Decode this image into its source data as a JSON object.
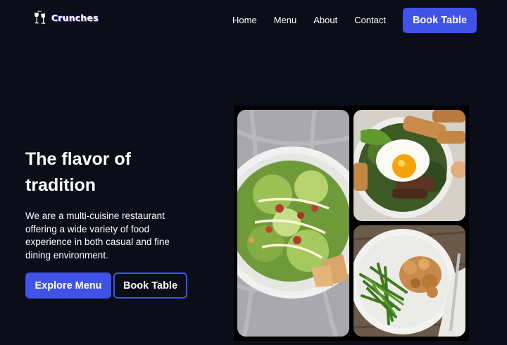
{
  "header": {
    "logo_text": "Crunches",
    "logo_icon": "wine-glasses-icon",
    "nav": [
      "Home",
      "Menu",
      "About",
      "Contact"
    ],
    "cta_label": "Book Table"
  },
  "hero": {
    "title_line1": "The flavor of",
    "title_line2": "tradition",
    "description": "We are a multi-cuisine restaurant offering a wide variety of food experience in both casual and fine dining environment.",
    "primary_button": "Explore Menu",
    "secondary_button": "Book Table"
  },
  "colors": {
    "background": "#0b0e18",
    "accent": "#4152e8",
    "text": "#ffffff"
  },
  "collage": {
    "images": [
      "caesar-salad-image",
      "fried-egg-bowl-image",
      "chicken-green-beans-image"
    ]
  }
}
